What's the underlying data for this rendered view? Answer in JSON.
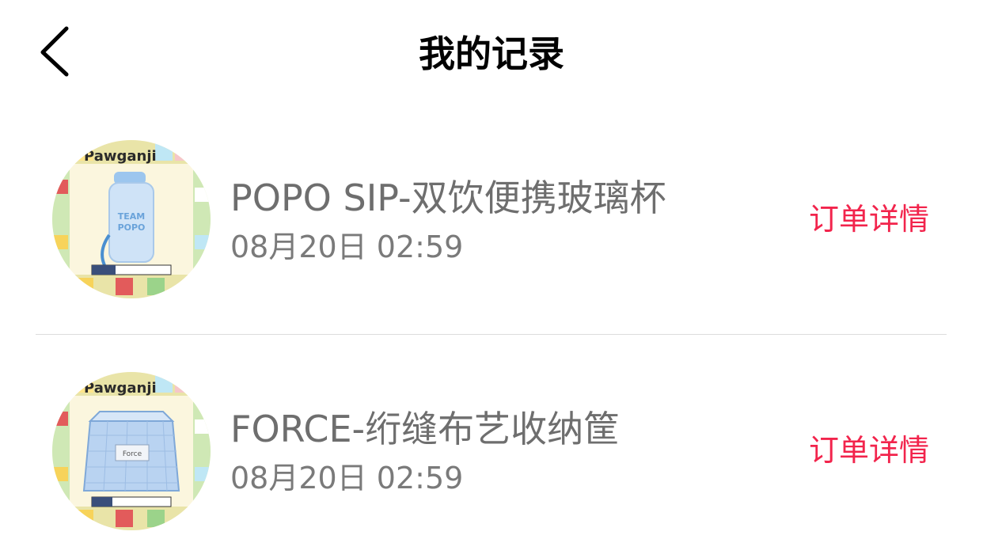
{
  "header": {
    "title": "我的记录",
    "back_icon": "chevron-left-icon"
  },
  "records": [
    {
      "title": "POPO SIP-双饮便携玻璃杯",
      "time": "08月20日 02:59",
      "detail_label": "订单详情",
      "thumb_label": "POPO'S SIP 双饮便携玻璃杯",
      "thumb_product_text": "TEAM POPO",
      "thumb_brand_text": "Pawganji PAWoPoly"
    },
    {
      "title": "FORCE-绗缝布艺收纳筐",
      "time": "08月20日 02:59",
      "detail_label": "订单详情",
      "thumb_label": "FORCE 绗缝布艺收纳筐",
      "thumb_product_text": "Force",
      "thumb_brand_text": "Pawganji PAWoPoly"
    }
  ],
  "colors": {
    "accent": "#f2244c",
    "title_text": "#6e6e6e",
    "divider": "#dcdcdc"
  }
}
